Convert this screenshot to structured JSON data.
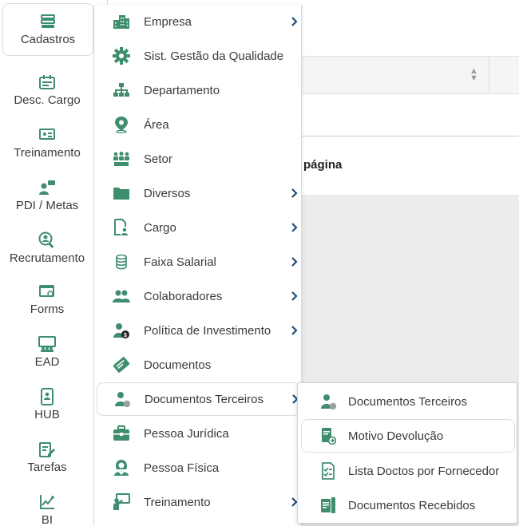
{
  "colors": {
    "accent": "#3e8e6e",
    "accent_dark": "#2f6f56",
    "chevron": "#1f4e79"
  },
  "sidebar": {
    "items": [
      {
        "label": "Cadastros",
        "icon": "list-icon"
      },
      {
        "label": "Desc. Cargo",
        "icon": "calendar-icon"
      },
      {
        "label": "Treinamento",
        "icon": "presentation-icon"
      },
      {
        "label": "PDI / Metas",
        "icon": "person-chat-icon"
      },
      {
        "label": "Recrutamento",
        "icon": "search-person-icon"
      },
      {
        "label": "Forms",
        "icon": "form-icon"
      },
      {
        "label": "EAD",
        "icon": "classroom-icon"
      },
      {
        "label": "HUB",
        "icon": "mobile-icon"
      },
      {
        "label": "Tarefas",
        "icon": "edit-document-icon"
      },
      {
        "label": "BI",
        "icon": "chart-icon"
      }
    ]
  },
  "menu": {
    "items": [
      {
        "label": "Empresa",
        "icon": "building-icon",
        "has_submenu": true
      },
      {
        "label": "Sist. Gestão da Qualidade",
        "icon": "gear-icon",
        "has_submenu": false
      },
      {
        "label": "Departamento",
        "icon": "org-chart-icon",
        "has_submenu": false
      },
      {
        "label": "Área",
        "icon": "location-pin-icon",
        "has_submenu": false
      },
      {
        "label": "Setor",
        "icon": "team-icon",
        "has_submenu": false
      },
      {
        "label": "Diversos",
        "icon": "folder-icon",
        "has_submenu": true
      },
      {
        "label": "Cargo",
        "icon": "document-person-icon",
        "has_submenu": true
      },
      {
        "label": "Faixa Salarial",
        "icon": "coins-icon",
        "has_submenu": true
      },
      {
        "label": "Colaboradores",
        "icon": "people-icon",
        "has_submenu": true
      },
      {
        "label": "Política de Investimento",
        "icon": "person-money-icon",
        "has_submenu": true
      },
      {
        "label": "Documentos",
        "icon": "certificate-icon",
        "has_submenu": false
      },
      {
        "label": "Documentos Terceiros",
        "icon": "person-doc-icon",
        "has_submenu": true
      },
      {
        "label": "Pessoa Jurídica",
        "icon": "briefcase-icon",
        "has_submenu": false
      },
      {
        "label": "Pessoa Física",
        "icon": "person-female-icon",
        "has_submenu": false
      },
      {
        "label": "Treinamento",
        "icon": "trainer-icon",
        "has_submenu": true
      }
    ]
  },
  "submenu": {
    "items": [
      {
        "label": "Documentos Terceiros",
        "icon": "person-doc-icon"
      },
      {
        "label": "Motivo Devolução",
        "icon": "document-return-icon"
      },
      {
        "label": "Lista Doctos por Fornecedor",
        "icon": "checklist-icon"
      },
      {
        "label": "Documentos Recebidos",
        "icon": "received-docs-icon"
      }
    ]
  },
  "background": {
    "table_header_fragment": "página"
  }
}
